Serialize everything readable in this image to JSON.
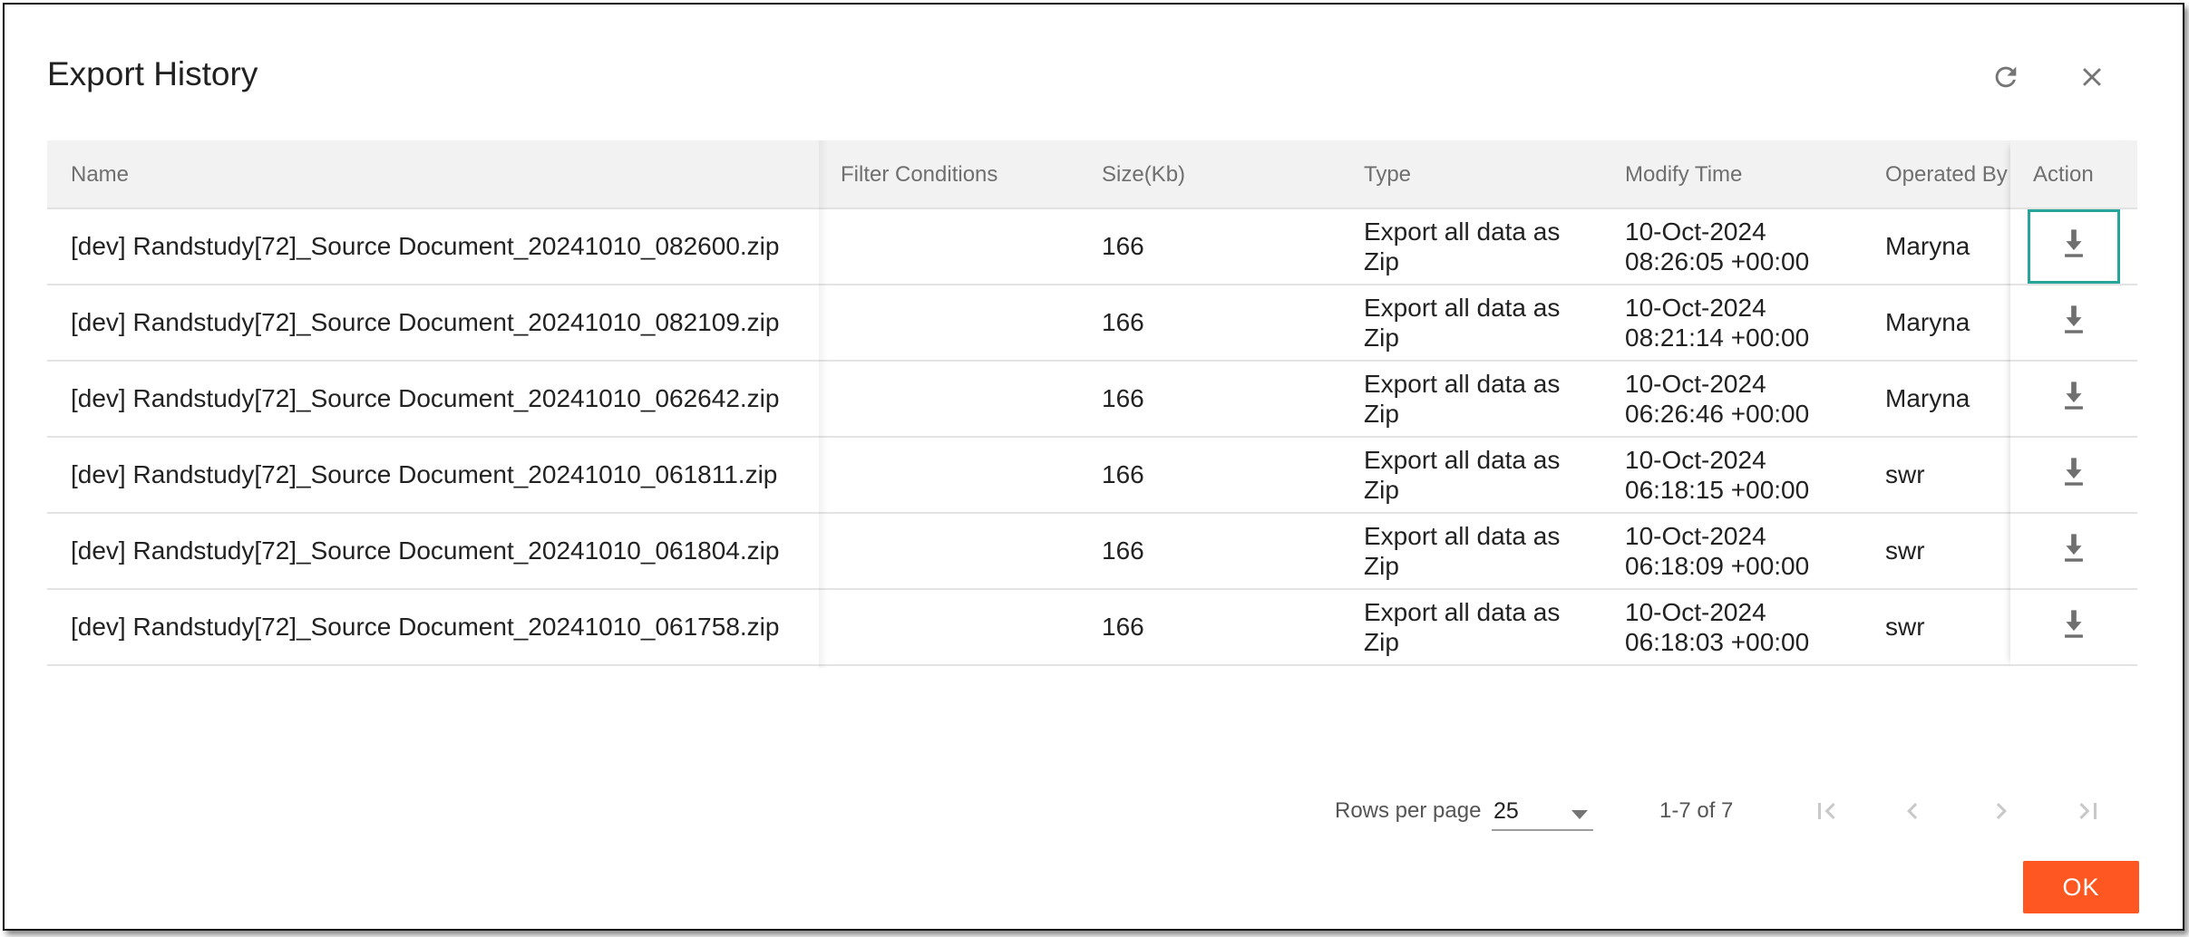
{
  "dialog": {
    "title": "Export History"
  },
  "table": {
    "columns": {
      "name": "Name",
      "filter": "Filter Conditions",
      "size": "Size(Kb)",
      "type": "Type",
      "time": "Modify Time",
      "operator": "Operated By",
      "action": "Action"
    },
    "rows": [
      {
        "name": "[dev] Randstudy[72]_Source Document_20241010_082600.zip",
        "filter": "",
        "size": "166",
        "type_line1": "Export all data as",
        "type_line2": "Zip",
        "time_line1": "10-Oct-2024",
        "time_line2": "08:26:05 +00:00",
        "operator": "Maryna"
      },
      {
        "name": "[dev] Randstudy[72]_Source Document_20241010_082109.zip",
        "filter": "",
        "size": "166",
        "type_line1": "Export all data as",
        "type_line2": "Zip",
        "time_line1": "10-Oct-2024",
        "time_line2": "08:21:14 +00:00",
        "operator": "Maryna"
      },
      {
        "name": "[dev] Randstudy[72]_Source Document_20241010_062642.zip",
        "filter": "",
        "size": "166",
        "type_line1": "Export all data as",
        "type_line2": "Zip",
        "time_line1": "10-Oct-2024",
        "time_line2": "06:26:46 +00:00",
        "operator": "Maryna"
      },
      {
        "name": "[dev] Randstudy[72]_Source Document_20241010_061811.zip",
        "filter": "",
        "size": "166",
        "type_line1": "Export all data as",
        "type_line2": "Zip",
        "time_line1": "10-Oct-2024",
        "time_line2": "06:18:15 +00:00",
        "operator": "swr"
      },
      {
        "name": "[dev] Randstudy[72]_Source Document_20241010_061804.zip",
        "filter": "",
        "size": "166",
        "type_line1": "Export all data as",
        "type_line2": "Zip",
        "time_line1": "10-Oct-2024",
        "time_line2": "06:18:09 +00:00",
        "operator": "swr"
      },
      {
        "name": "[dev] Randstudy[72]_Source Document_20241010_061758.zip",
        "filter": "",
        "size": "166",
        "type_line1": "Export all data as",
        "type_line2": "Zip",
        "time_line1": "10-Oct-2024",
        "time_line2": "06:18:03 +00:00",
        "operator": "swr"
      }
    ]
  },
  "pagination": {
    "rows_per_page_label": "Rows per page",
    "rows_per_page_value": "25",
    "range_text": "1-7 of 7"
  },
  "actions": {
    "ok_label": "OK"
  },
  "icons": {
    "refresh": "refresh-icon",
    "close": "close-icon",
    "download": "download-icon",
    "first_page": "first-page-icon",
    "prev_page": "chevron-left-icon",
    "next_page": "chevron-right-icon",
    "last_page": "last-page-icon",
    "dropdown": "caret-down-icon"
  },
  "colors": {
    "accent_ok": "#ff5722",
    "focus_outline": "#26a69a",
    "header_bg": "#f2f2f2"
  }
}
